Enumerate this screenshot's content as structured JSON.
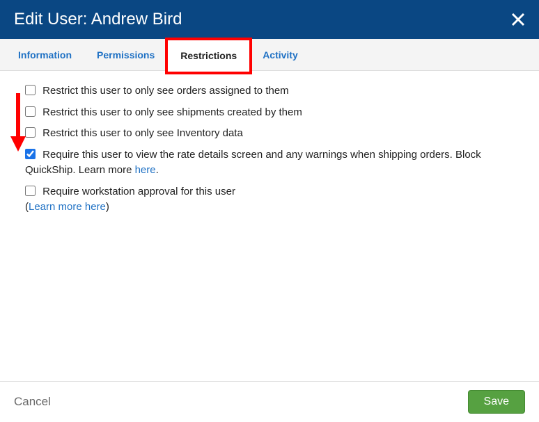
{
  "header": {
    "title": "Edit User: Andrew Bird"
  },
  "tabs": [
    {
      "label": "Information",
      "active": false
    },
    {
      "label": "Permissions",
      "active": false
    },
    {
      "label": "Restrictions",
      "active": true
    },
    {
      "label": "Activity",
      "active": false
    }
  ],
  "restrictions": [
    {
      "label": "Restrict this user to only see orders assigned to them",
      "checked": false
    },
    {
      "label": "Restrict this user to only see shipments created by them",
      "checked": false
    },
    {
      "label": "Restrict this user to only see Inventory data",
      "checked": false
    },
    {
      "label_prefix": "Require this user to view the rate details screen and any warnings when shipping orders. Block QuickShip. Learn more ",
      "link_text": "here",
      "label_suffix": ".",
      "checked": true
    },
    {
      "label": "Require workstation approval for this user",
      "sub_prefix": "(",
      "sub_link": "Learn more here",
      "sub_suffix": ")",
      "checked": false
    }
  ],
  "footer": {
    "cancel": "Cancel",
    "save": "Save"
  },
  "annotations": {
    "active_tab_highlight": true,
    "left_arrow": true
  }
}
